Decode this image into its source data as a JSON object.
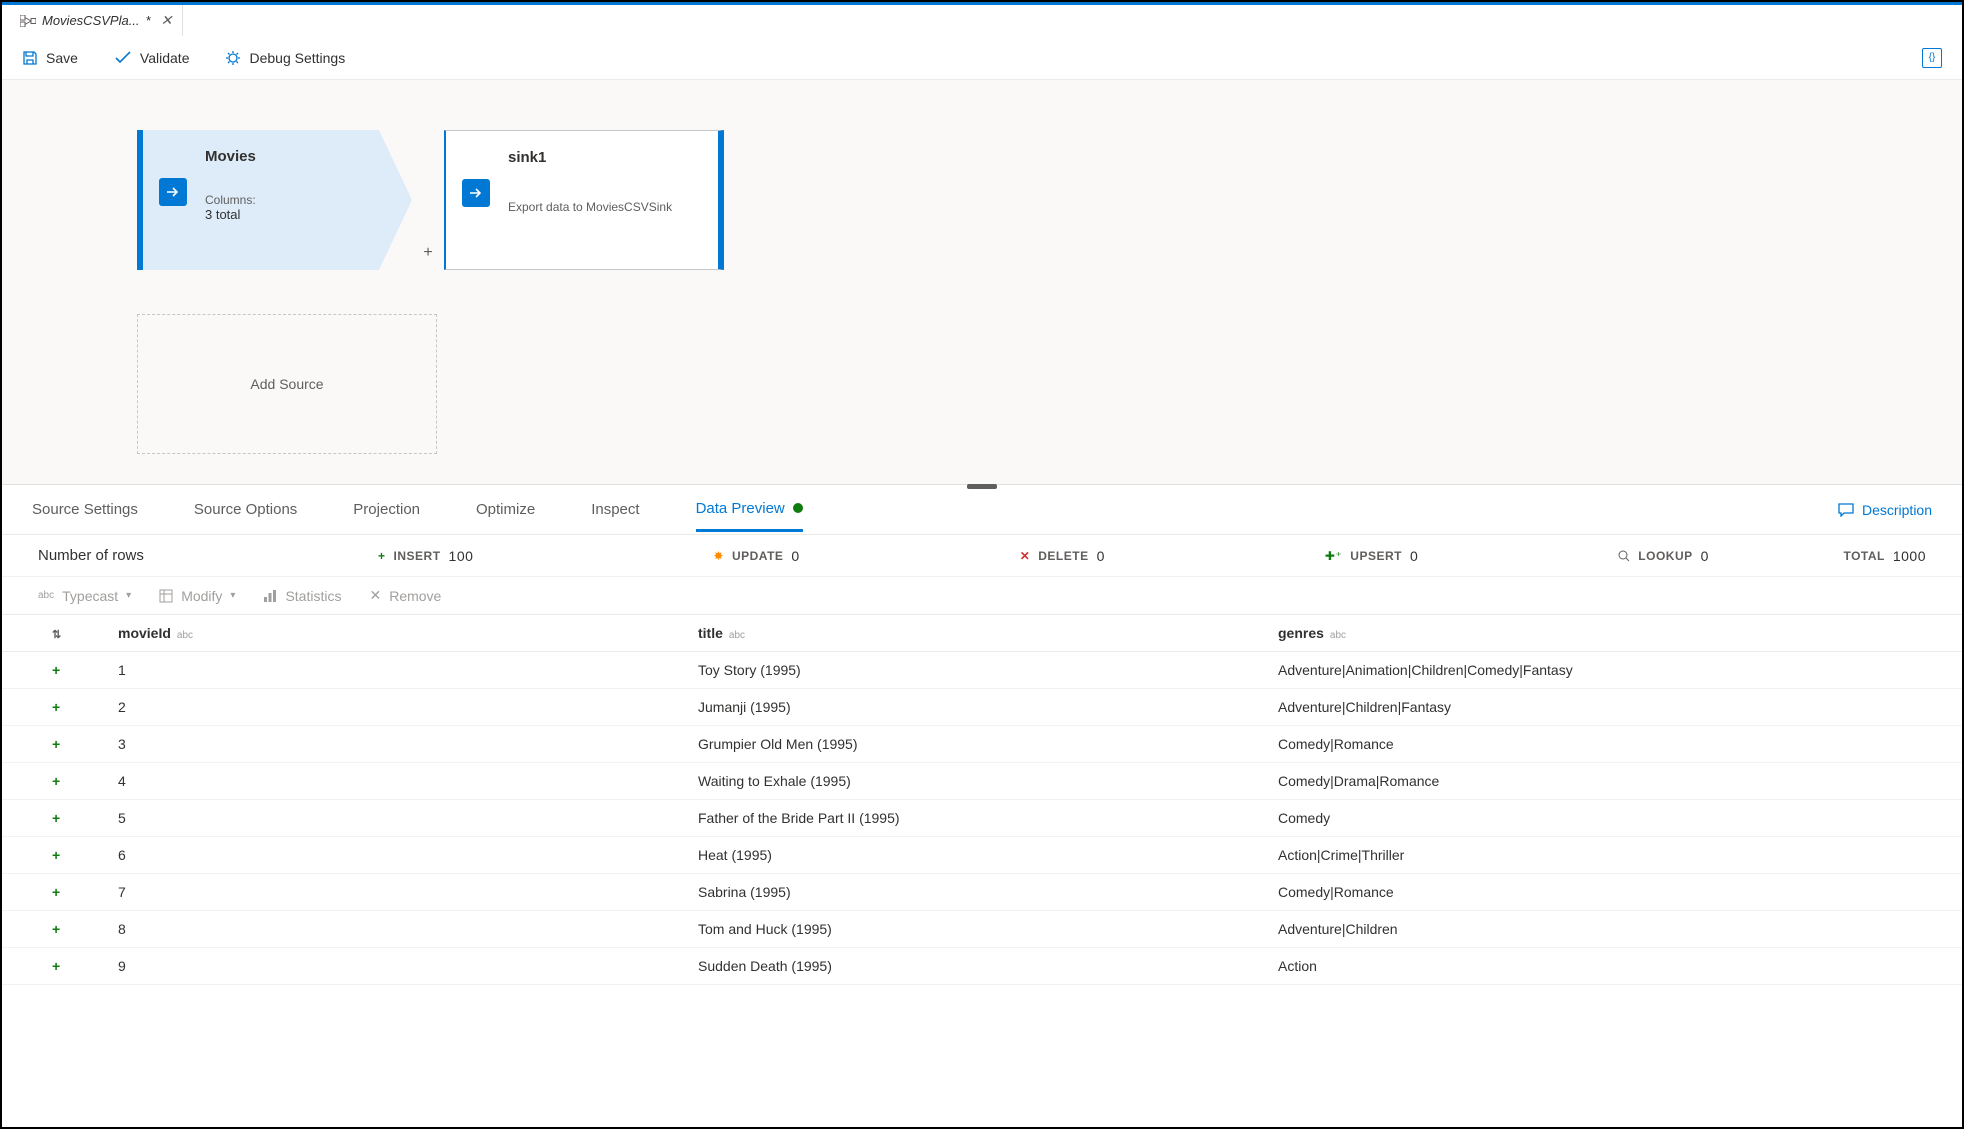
{
  "tab": {
    "title": "MoviesCSVPla...",
    "dirty": "*"
  },
  "toolbar": {
    "save": "Save",
    "validate": "Validate",
    "debug": "Debug Settings",
    "code": "{}"
  },
  "flow": {
    "source": {
      "name": "Movies",
      "columns_label": "Columns:",
      "columns_count": "3 total"
    },
    "sink": {
      "name": "sink1",
      "desc": "Export data to MoviesCSVSink"
    },
    "add_source": "Add Source"
  },
  "tabs": {
    "source_settings": "Source Settings",
    "source_options": "Source Options",
    "projection": "Projection",
    "optimize": "Optimize",
    "inspect": "Inspect",
    "data_preview": "Data Preview",
    "description": "Description"
  },
  "stats": {
    "rows_label": "Number of rows",
    "insert": {
      "label": "INSERT",
      "value": "100"
    },
    "update": {
      "label": "UPDATE",
      "value": "0"
    },
    "delete": {
      "label": "DELETE",
      "value": "0"
    },
    "upsert": {
      "label": "UPSERT",
      "value": "0"
    },
    "lookup": {
      "label": "LOOKUP",
      "value": "0"
    },
    "total": {
      "label": "TOTAL",
      "value": "1000"
    }
  },
  "grid_tools": {
    "typecast": "Typecast",
    "modify": "Modify",
    "statistics": "Statistics",
    "remove": "Remove"
  },
  "columns": {
    "movieId": "movieId",
    "title": "title",
    "genres": "genres",
    "abc": "abc"
  },
  "rows": [
    {
      "movieId": "1",
      "title": "Toy Story (1995)",
      "genres": "Adventure|Animation|Children|Comedy|Fantasy"
    },
    {
      "movieId": "2",
      "title": "Jumanji (1995)",
      "genres": "Adventure|Children|Fantasy"
    },
    {
      "movieId": "3",
      "title": "Grumpier Old Men (1995)",
      "genres": "Comedy|Romance"
    },
    {
      "movieId": "4",
      "title": "Waiting to Exhale (1995)",
      "genres": "Comedy|Drama|Romance"
    },
    {
      "movieId": "5",
      "title": "Father of the Bride Part II (1995)",
      "genres": "Comedy"
    },
    {
      "movieId": "6",
      "title": "Heat (1995)",
      "genres": "Action|Crime|Thriller"
    },
    {
      "movieId": "7",
      "title": "Sabrina (1995)",
      "genres": "Comedy|Romance"
    },
    {
      "movieId": "8",
      "title": "Tom and Huck (1995)",
      "genres": "Adventure|Children"
    },
    {
      "movieId": "9",
      "title": "Sudden Death (1995)",
      "genres": "Action"
    }
  ]
}
